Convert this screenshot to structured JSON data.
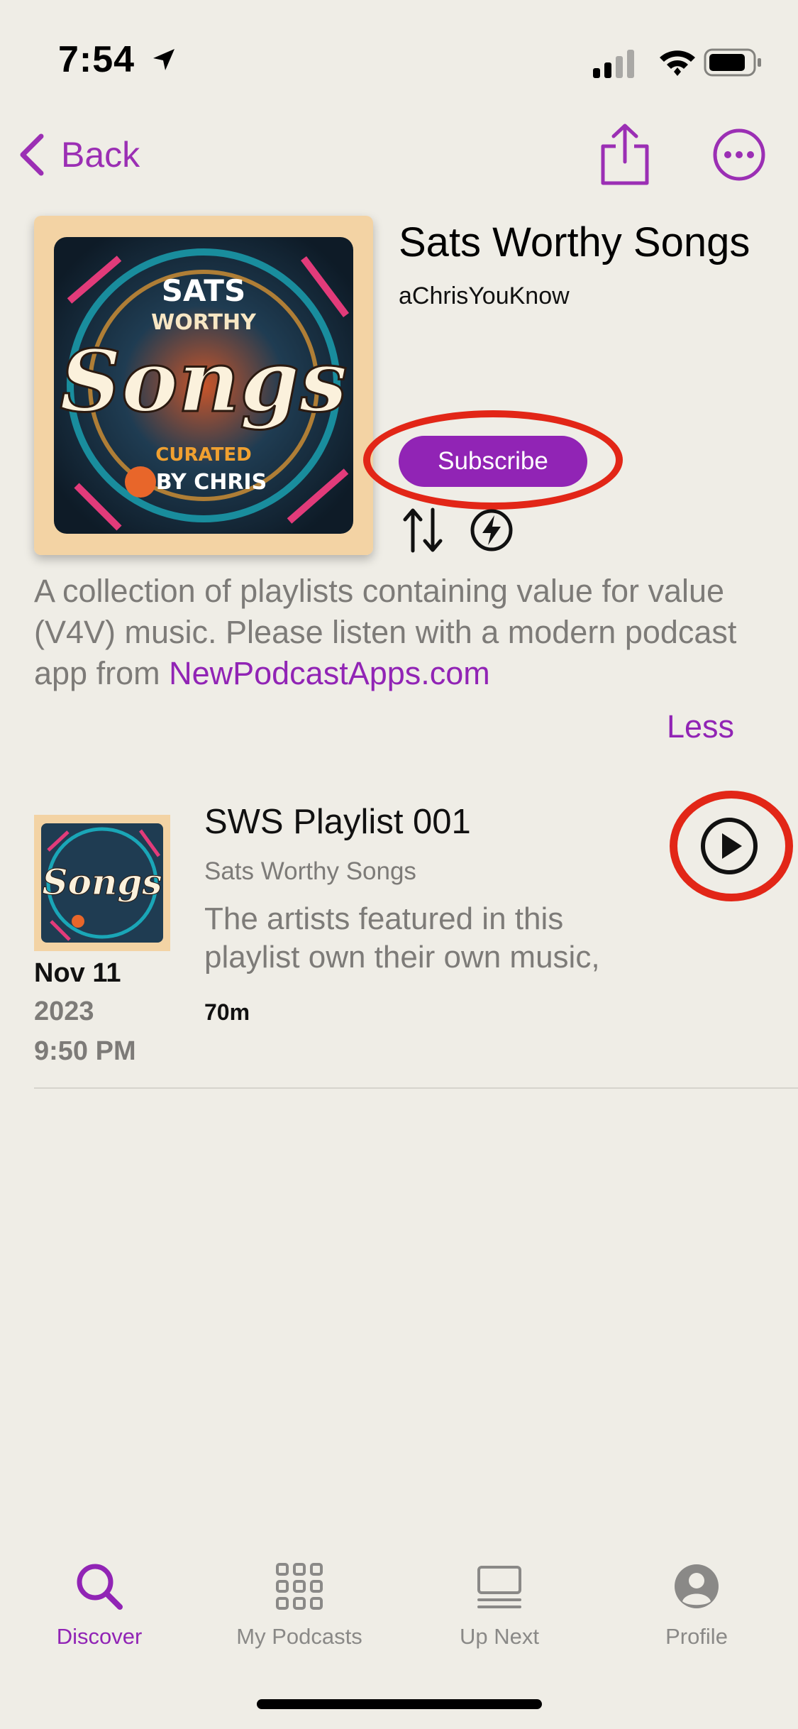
{
  "status_bar": {
    "time": "7:54"
  },
  "nav": {
    "back_label": "Back"
  },
  "podcast": {
    "title": "Sats Worthy Songs",
    "author": "aChrisYouKnow",
    "subscribe_label": "Subscribe",
    "cover_art_text": [
      "SATS",
      "WORTHY",
      "Songs",
      "CURATED",
      "BY CHRIS"
    ],
    "description_text": "A collection of playlists containing value for value (V4V) music. Please listen with a modern podcast app from ",
    "description_link": "NewPodcastApps.com",
    "less_label": "Less"
  },
  "episodes": [
    {
      "title": "SWS Playlist 001",
      "show": "Sats Worthy Songs",
      "summary": "The artists featured in this playlist own their own music,",
      "duration": "70m",
      "date": "Nov 11",
      "year": "2023",
      "time": "9:50 PM"
    }
  ],
  "tab_bar": {
    "items": [
      {
        "label": "Discover",
        "icon": "magnifier-icon",
        "active": true
      },
      {
        "label": "My Podcasts",
        "icon": "grid-icon",
        "active": false
      },
      {
        "label": "Up Next",
        "icon": "queue-icon",
        "active": false
      },
      {
        "label": "Profile",
        "icon": "person-icon",
        "active": false
      }
    ]
  },
  "colors": {
    "accent": "#9124b5",
    "highlight_ring": "#e22617",
    "background": "#efede6",
    "secondary_text": "#7d7b78"
  }
}
